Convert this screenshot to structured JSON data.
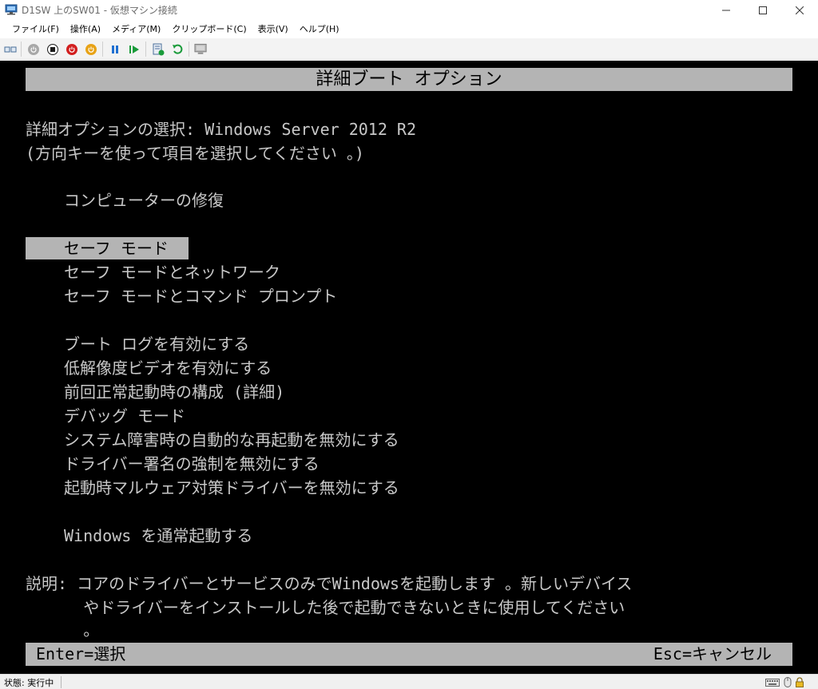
{
  "window": {
    "title": "D1SW 上のSW01 - 仮想マシン接続",
    "controls": {
      "minimize": "—",
      "maximize": "☐",
      "close": "✕"
    }
  },
  "menu": {
    "items": [
      "ファイル(F)",
      "操作(A)",
      "メディア(M)",
      "クリップボード(C)",
      "表示(V)",
      "ヘルプ(H)"
    ]
  },
  "toolbar": {
    "buttons": [
      {
        "name": "ctrl-alt-del-icon"
      },
      {
        "name": "start-icon"
      },
      {
        "name": "turn-off-icon"
      },
      {
        "name": "shutdown-icon"
      },
      {
        "name": "save-state-icon"
      },
      {
        "name": "pause-icon"
      },
      {
        "name": "resume-icon"
      },
      {
        "name": "checkpoint-icon"
      },
      {
        "name": "revert-icon"
      },
      {
        "name": "enhanced-session-icon"
      }
    ],
    "colors": {
      "stop": "#1b1b1b",
      "turn_off": "#d21f1f",
      "shutdown": "#e8a317",
      "pause": "#1d6fd1",
      "resume": "#1a9b3a"
    }
  },
  "vm": {
    "header": "詳細ブート オプション",
    "prompt_line1": "詳細オプションの選択: Windows Server 2012 R2",
    "prompt_line2": "(方向キーを使って項目を選択してください 。)",
    "options": {
      "repair": "コンピューターの修復",
      "safe_mode": "セーフ モード",
      "safe_mode_network": "セーフ モードとネットワーク",
      "safe_mode_cmd": "セーフ モードとコマンド プロンプト",
      "boot_log": "ブート ログを有効にする",
      "low_res": "低解像度ビデオを有効にする",
      "last_known_good": "前回正常起動時の構成 (詳細)",
      "debug": "デバッグ モード",
      "disable_auto_restart": "システム障害時の自動的な再起動を無効にする",
      "disable_driver_sig": "ドライバー署名の強制を無効にする",
      "disable_elam": "起動時マルウェア対策ドライバーを無効にする",
      "start_normal": "Windows を通常起動する"
    },
    "selected": "safe_mode",
    "description_line1": "説明: コアのドライバーとサービスのみでWindowsを起動します 。新しいデバイス",
    "description_line2": "      やドライバーをインストールした後で起動できないときに使用してください",
    "description_line3": "      。",
    "footer_left": "Enter=選択",
    "footer_right": "Esc=キャンセル",
    "colors": {
      "background": "#000000",
      "text": "#c8c8c8",
      "highlight": "#b4b4b4"
    }
  },
  "statusbar": {
    "status": "状態: 実行中",
    "icons": [
      "keyboard-icon",
      "mouse-icon",
      "lock-icon"
    ]
  }
}
